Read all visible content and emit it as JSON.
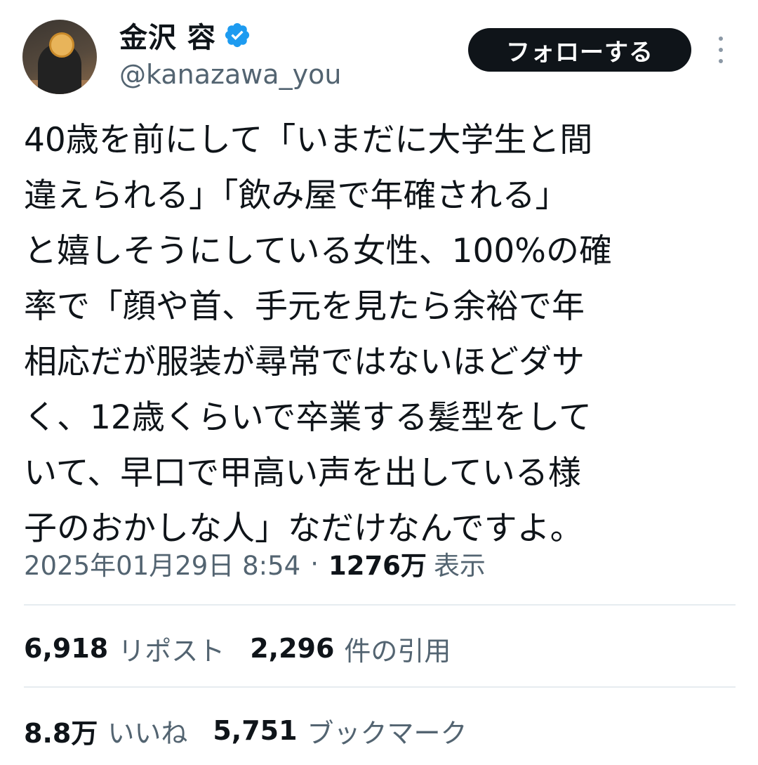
{
  "author": {
    "name": "金沢 容",
    "handle": "@kanazawa_you",
    "verified": true,
    "verified_color": "#1d9bf0"
  },
  "actions": {
    "follow_label": "フォローする",
    "more_icon": "more-vertical-icon"
  },
  "tweet": {
    "text": "40歳を前にして「いまだに大学生と間\n違えられる」「飲み屋で年確される」\nと嬉しそうにしている女性、100%の確\n率で「顔や首、手元を見たら余裕で年\n相応だが服装が尋常ではないほどダサ\nく、12歳くらいで卒業する髪型をして\nいて、早口で甲高い声を出している様\n子のおかしな人」なだけなんですよ。"
  },
  "meta": {
    "timestamp": "2025年01月29日 8:54",
    "separator": "·",
    "views_count": "1276万",
    "views_label": "表示"
  },
  "stats": {
    "reposts_count": "6,918",
    "reposts_label": "リポスト",
    "quotes_count": "2,296",
    "quotes_label": "件の引用",
    "likes_count": "8.8万",
    "likes_label": "いいね",
    "bookmarks_count": "5,751",
    "bookmarks_label": "ブックマーク"
  },
  "colors": {
    "text_primary": "#0f1419",
    "text_secondary": "#536471",
    "button_bg": "#0f1419",
    "divider": "#e6ecf0"
  }
}
